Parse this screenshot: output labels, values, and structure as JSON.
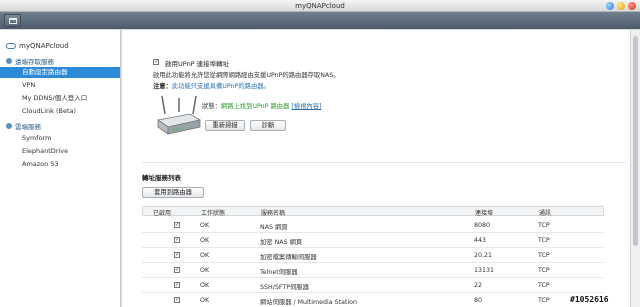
{
  "window": {
    "title": "myQNAPcloud"
  },
  "sidebar": {
    "root_label": "myQNAPcloud",
    "groups": [
      {
        "label": "遠端存取服務",
        "items": [
          {
            "label": "自動設定路由器",
            "active": true
          },
          {
            "label": "VPN",
            "active": false
          },
          {
            "label": "My DDNS/個人登入口",
            "active": false
          },
          {
            "label": "CloudLink (Beta)",
            "active": false
          }
        ]
      },
      {
        "label": "雲端服務",
        "items": [
          {
            "label": "Symform",
            "active": false
          },
          {
            "label": "ElephantDrive",
            "active": false
          },
          {
            "label": "Amazon S3",
            "active": false
          }
        ]
      }
    ]
  },
  "upnp": {
    "enable_label": "啟用UPnP 連接埠轉址",
    "enable_checked": "✓",
    "description": "啟用此功能將允許您從網際網路經由支援UPnP的路由器存取NAS。",
    "note_label": "注意：",
    "note_text": "此功能只支援具備UPnP的路由器。",
    "status_prefix": "狀態：",
    "status_text": "網路上找到UPnP 路由器",
    "status_link": "[檢視內容]",
    "rescan_button": "重新掃描",
    "diagnose_button": "診斷"
  },
  "forwarding": {
    "section_title": "轉址服務列表",
    "apply_button": "套用到路由器",
    "columns": [
      "已啟用",
      "工作狀態",
      "服務名稱",
      "連接埠",
      "通訊"
    ],
    "rows": [
      {
        "enabled": "✓",
        "status": "OK",
        "service": "NAS 網頁",
        "port": "8080",
        "protocol": "TCP"
      },
      {
        "enabled": "✓",
        "status": "OK",
        "service": "加密 NAS 網頁",
        "port": "443",
        "protocol": "TCP"
      },
      {
        "enabled": "✓",
        "status": "OK",
        "service": "加密檔案傳輸伺服器",
        "port": "20,21",
        "protocol": "TCP"
      },
      {
        "enabled": "✓",
        "status": "OK",
        "service": "Telnet伺服器",
        "port": "13131",
        "protocol": "TCP"
      },
      {
        "enabled": "✓",
        "status": "OK",
        "service": "SSH/SFTP伺服器",
        "port": "22",
        "protocol": "TCP"
      },
      {
        "enabled": "✓",
        "status": "OK",
        "service": "網站伺服器 / Multimedia Station",
        "port": "80",
        "protocol": "TCP"
      }
    ]
  },
  "watermark": "#1052616"
}
